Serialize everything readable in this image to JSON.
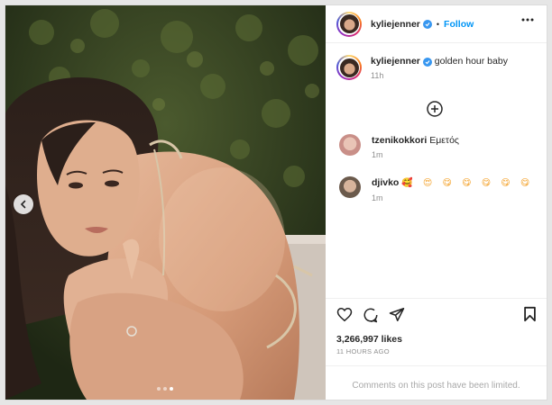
{
  "post": {
    "author": {
      "username": "kyliejenner",
      "verified": true
    },
    "header": {
      "separator": "•",
      "follow_label": "Follow"
    },
    "caption": {
      "text": "golden hour baby",
      "time": "11h"
    },
    "comments": [
      {
        "username": "tzenikokkori",
        "text": "Εμετός",
        "time": "1m"
      },
      {
        "username": "djivko",
        "text": "🥰 😍 😋 😋 😋 😋 😋",
        "time": "1m"
      }
    ],
    "stats": {
      "likes": "3,266,997 likes",
      "posted": "11 HOURS AGO"
    },
    "comments_limited": "Comments on this post have been limited.",
    "carousel": {
      "slide_count": 3,
      "active_index": 2
    }
  },
  "icons": {
    "more": "more-horizontal-icon",
    "add": "add-circle-icon",
    "like": "heart-icon",
    "comment": "comment-icon",
    "share": "share-icon",
    "save": "bookmark-icon",
    "prev": "chevron-left-icon"
  },
  "colors": {
    "accent": "#0095f6",
    "verified": "#3897f0",
    "muted": "#8e8e8e"
  }
}
